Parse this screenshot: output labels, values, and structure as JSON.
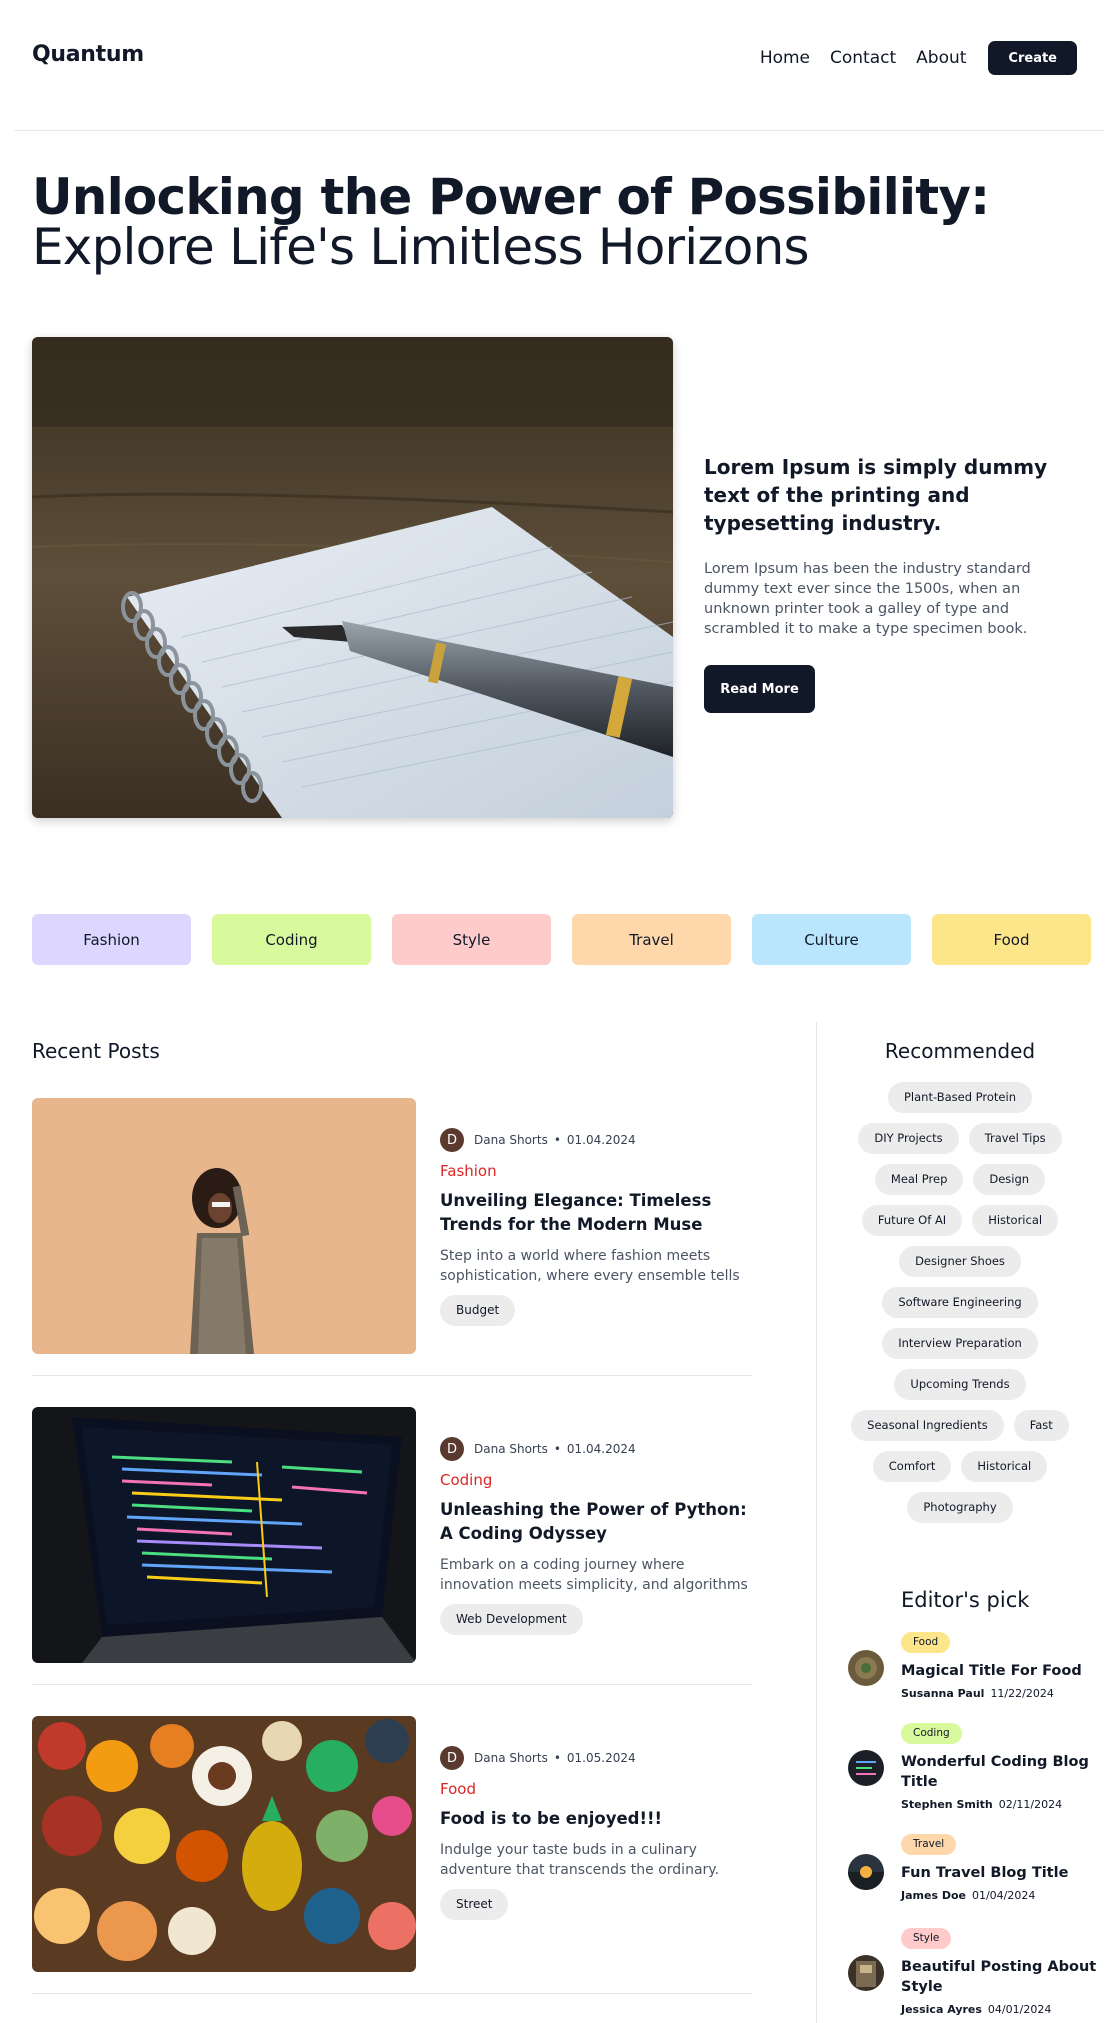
{
  "header": {
    "logo": "Quantum",
    "nav": [
      "Home",
      "Contact",
      "About"
    ],
    "create_label": "Create"
  },
  "hero": {
    "title_bold": "Unlocking the Power of Possibility:",
    "title_light": " Explore Life's Limitless Horizons",
    "card_title": "Lorem Ipsum is simply dummy text of the printing and typesetting industry.",
    "card_text": "Lorem Ipsum has been the industry standard dummy text ever since the 1500s, when an unknown printer took a galley of type and scrambled it to make a type specimen book.",
    "read_more_label": "Read More",
    "image": "notebook-with-fountain-pen"
  },
  "categories": [
    {
      "label": "Fashion",
      "color": "#ddd6fe"
    },
    {
      "label": "Coding",
      "color": "#d9f99d"
    },
    {
      "label": "Style",
      "color": "#fecaca"
    },
    {
      "label": "Travel",
      "color": "#fed7aa"
    },
    {
      "label": "Culture",
      "color": "#bae6fd"
    },
    {
      "label": "Food",
      "color": "#fde68a"
    }
  ],
  "recent": {
    "title": "Recent Posts",
    "posts": [
      {
        "author_initial": "D",
        "author": "Dana Shorts",
        "date": "01.04.2024",
        "category": "Fashion",
        "title": "Unveiling Elegance: Timeless Trends for the Modern Muse",
        "excerpt": "Step into a world where fashion meets sophistication, where every ensemble tells a…",
        "tag": "Budget",
        "image": "fashion-woman-portrait"
      },
      {
        "author_initial": "D",
        "author": "Dana Shorts",
        "date": "01.04.2024",
        "category": "Coding",
        "title": "Unleashing the Power of Python: A Coding Odyssey",
        "excerpt": "Embark on a coding journey where innovation meets simplicity, and algorithms dance to the…",
        "tag": "Web Development",
        "image": "laptop-with-code"
      },
      {
        "author_initial": "D",
        "author": "Dana Shorts",
        "date": "01.05.2024",
        "category": "Food",
        "title": "Food is to be enjoyed!!!",
        "excerpt": "Indulge your taste buds in a culinary adventure that transcends the ordinary. From the sizzlin…",
        "tag": "Street",
        "image": "food-spread"
      }
    ]
  },
  "recommended": {
    "title": "Recommended",
    "tags": [
      "Plant-Based Protein",
      "DIY Projects",
      "Travel Tips",
      "Meal Prep",
      "Design",
      "Future Of AI",
      "Historical",
      "Designer Shoes",
      "Software Engineering",
      "Interview Preparation",
      "Upcoming Trends",
      "Seasonal Ingredients",
      "Fast",
      "Comfort",
      "Historical",
      "Photography"
    ]
  },
  "editors_pick": {
    "title": "Editor's pick",
    "items": [
      {
        "category": "Food",
        "color": "#fde68a",
        "title": "Magical Title For Food",
        "author": "Susanna Paul",
        "date": "11/22/2024"
      },
      {
        "category": "Coding",
        "color": "#d9f99d",
        "title": "Wonderful Coding Blog Title",
        "author": "Stephen Smith",
        "date": "02/11/2024"
      },
      {
        "category": "Travel",
        "color": "#fed7aa",
        "title": "Fun Travel Blog Title",
        "author": "James Doe",
        "date": "01/04/2024"
      },
      {
        "category": "Style",
        "color": "#fecaca",
        "title": "Beautiful Posting About Style",
        "author": "Jessica Ayres",
        "date": "04/01/2024"
      }
    ]
  }
}
